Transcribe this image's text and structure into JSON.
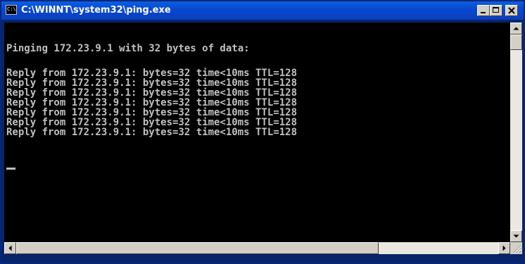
{
  "window": {
    "title": "C:\\WINNT\\system32\\ping.exe",
    "icon": "console-icon",
    "icon_text": "C:\\"
  },
  "console": {
    "lines": [
      "Pinging 172.23.9.1 with 32 bytes of data:",
      "",
      "Reply from 172.23.9.1: bytes=32 time<10ms TTL=128",
      "Reply from 172.23.9.1: bytes=32 time<10ms TTL=128",
      "Reply from 172.23.9.1: bytes=32 time<10ms TTL=128",
      "Reply from 172.23.9.1: bytes=32 time<10ms TTL=128",
      "Reply from 172.23.9.1: bytes=32 time<10ms TTL=128",
      "Reply from 172.23.9.1: bytes=32 time<10ms TTL=128",
      "Reply from 172.23.9.1: bytes=32 time<10ms TTL=128"
    ],
    "text_color": "#c0c0c0",
    "background": "#000000"
  },
  "colors": {
    "titlebar": "#0a48d0",
    "chrome": "#d4d0c8",
    "scroll_track": "#eae8e0"
  }
}
